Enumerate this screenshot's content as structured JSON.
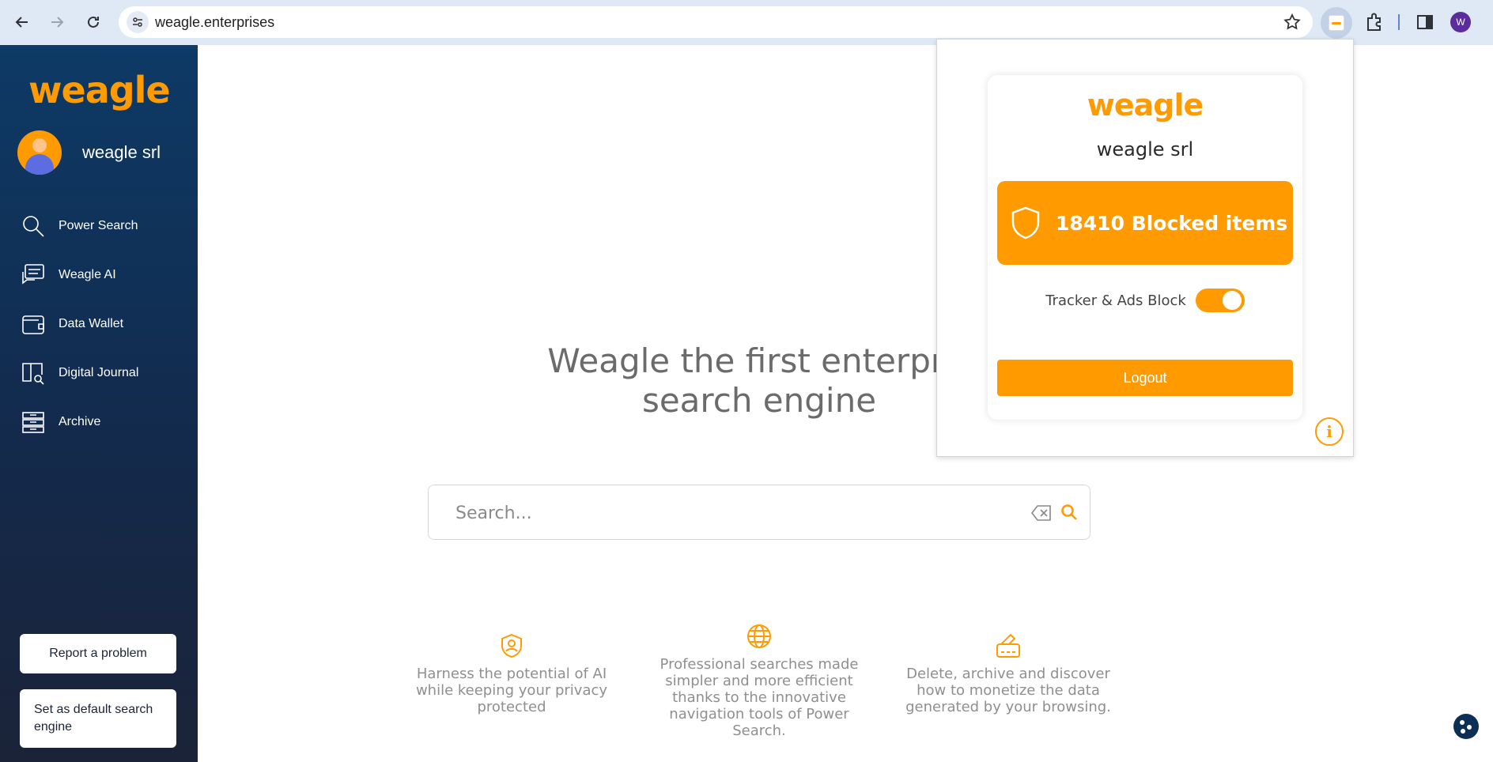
{
  "browser": {
    "url": "weagle.enterprises",
    "profile_initial": "W"
  },
  "sidebar": {
    "brand": "weagle",
    "user_name": "weagle srl",
    "items": [
      {
        "label": "Power Search",
        "icon": "search-icon"
      },
      {
        "label": "Weagle AI",
        "icon": "chat-icon"
      },
      {
        "label": "Data Wallet",
        "icon": "wallet-icon"
      },
      {
        "label": "Digital Journal",
        "icon": "journal-icon"
      },
      {
        "label": "Archive",
        "icon": "archive-icon"
      }
    ],
    "report_label": "Report a problem",
    "default_label": "Set as default search engine"
  },
  "main": {
    "headline_line1": "Weagle the first enterpris",
    "headline_line2": "search engine",
    "search_placeholder": "Search...",
    "features": [
      {
        "icon": "shield-user-icon",
        "text": "Harness the potential of AI while keeping your privacy protected"
      },
      {
        "icon": "globe-icon",
        "text": "Professional searches made simpler and more efficient thanks to the innovative navigation tools of Power Search."
      },
      {
        "icon": "card-edit-icon",
        "text": "Delete, archive and discover how to monetize the data generated by your browsing."
      }
    ]
  },
  "popup": {
    "brand": "weagle",
    "user_name": "weagle srl",
    "blocked_text": "18410 Blocked items",
    "toggle_label": "Tracker & Ads Block",
    "toggle_on": true,
    "logout_label": "Logout",
    "info_glyph": "i"
  },
  "colors": {
    "accent": "#ff9b00",
    "sidebar_top": "#0d3a66",
    "sidebar_bottom": "#1b2338"
  }
}
